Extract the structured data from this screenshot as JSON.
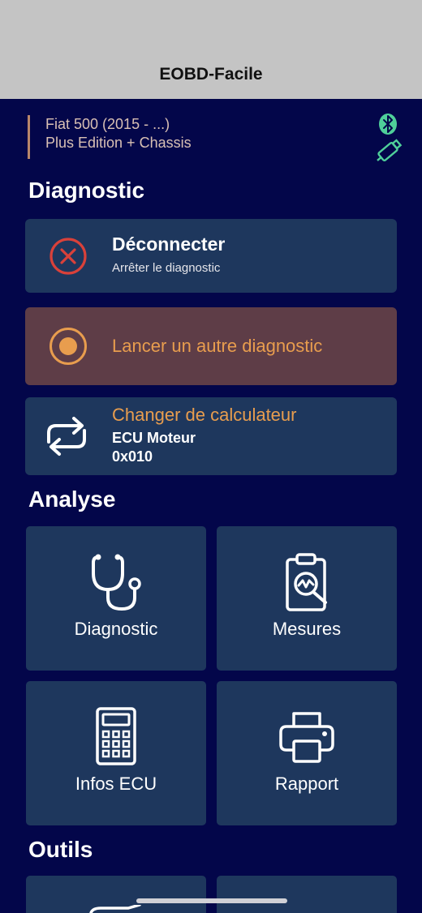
{
  "app": {
    "title": "EOBD-Facile"
  },
  "vehicle": {
    "model": "Fiat 500 (2015 - ...)",
    "edition": "Plus Edition + Chassis"
  },
  "connection": {
    "bluetooth_icon": "bluetooth-icon",
    "obd_icon": "obd-connector-icon",
    "status_color": "#4fcf9a"
  },
  "sections": {
    "diagnostic": "Diagnostic",
    "analyse": "Analyse",
    "outils": "Outils"
  },
  "disconnect": {
    "title": "Déconnecter",
    "subtitle": "Arrêter le diagnostic",
    "icon": "close-circle-icon",
    "icon_color": "#d9413a"
  },
  "relaunch": {
    "title": "Lancer un autre diagnostic",
    "icon": "radio-circle-icon",
    "accent": "#e89d4e"
  },
  "change_ecu": {
    "title": "Changer de calculateur",
    "ecu_name": "ECU Moteur",
    "ecu_address": "0x010",
    "icon": "swap-arrows-icon"
  },
  "analyse_tiles": [
    {
      "label": "Diagnostic",
      "icon": "stethoscope-icon"
    },
    {
      "label": "Mesures",
      "icon": "clipboard-chart-icon"
    },
    {
      "label": "Infos ECU",
      "icon": "calculator-icon"
    },
    {
      "label": "Rapport",
      "icon": "printer-icon"
    }
  ],
  "colors": {
    "background": "#03064a",
    "card": "#1e375d",
    "warn_card": "#5e3d47",
    "accent": "#e89d4e"
  }
}
